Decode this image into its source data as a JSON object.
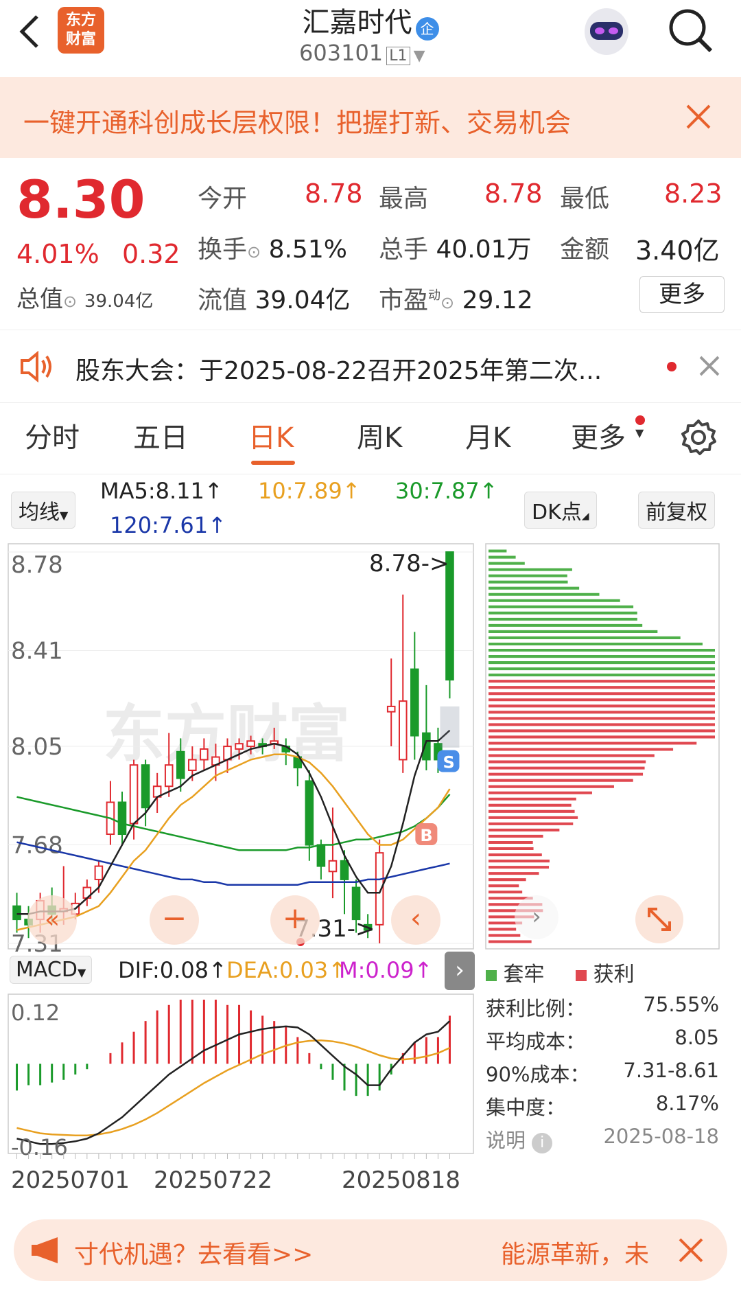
{
  "header": {
    "stock_name": "汇嘉时代",
    "badge": "企",
    "code": "603101",
    "level": "L1",
    "logo_line1": "东方",
    "logo_line2": "财富"
  },
  "banner": {
    "text": "一键开通科创成长层权限！把握打新、交易机会"
  },
  "quote": {
    "price": "8.30",
    "change_pct": "4.01%",
    "change_abs": "0.32",
    "open_label": "今开",
    "open": "8.78",
    "high_label": "最高",
    "high": "8.78",
    "low_label": "最低",
    "low": "8.23",
    "turnover_label": "换手",
    "turnover": "8.51%",
    "volume_label": "总手",
    "volume": "40.01万",
    "amount_label": "金额",
    "amount": "3.40亿",
    "total_value_label": "总值",
    "total_value": "39.04亿",
    "float_value_label": "流值",
    "float_value": "39.04亿",
    "pe_label": "市盈",
    "pe_sup": "动",
    "pe": "29.12",
    "more_label": "更多"
  },
  "notice": {
    "text": "股东大会：于2025-08-22召开2025年第二次..."
  },
  "tabs": [
    "分时",
    "五日",
    "日K",
    "周K",
    "月K",
    "更多"
  ],
  "active_tab": "日K",
  "indicators": {
    "ma_selector": "均线",
    "ma5": "MA5:8.11↑",
    "ma10": "10:7.89↑",
    "ma30": "30:7.87↑",
    "ma120": "120:7.61↑",
    "dk_button": "DK点",
    "adjust_button": "前复权"
  },
  "kline": {
    "y_labels": [
      "8.78",
      "8.41",
      "8.05",
      "7.68",
      "7.31"
    ],
    "max_annotation": "8.78->",
    "min_annotation": "7.31->",
    "watermark": "东方财富",
    "buy_marker": "B",
    "sell_marker": "S"
  },
  "macd": {
    "selector": "MACD",
    "dif": "DIF:0.08↑",
    "dea": "DEA:0.03↑",
    "m": "M:0.09↑",
    "y_top": "0.12",
    "y_bottom": "-0.16"
  },
  "x_labels": [
    "20250701",
    "20250722",
    "20250818"
  ],
  "chips": {
    "legend_trapped": "套牢",
    "legend_profit": "获利",
    "profit_ratio_label": "获利比例：",
    "profit_ratio": "75.55%",
    "avg_cost_label": "平均成本：",
    "avg_cost": "8.05",
    "cost90_label": "90%成本：",
    "cost90": "7.31-8.61",
    "concentration_label": "集中度：",
    "concentration": "8.17%",
    "explain_label": "说明",
    "date": "2025-08-18"
  },
  "footer_ad": {
    "left_text": "寸代机遇？去看看>>",
    "right_text": "能源革新，未"
  },
  "colors": {
    "up": "#e0292f",
    "down": "#1a9a2a",
    "accent": "#e8612c",
    "ma5": "#222222",
    "ma10": "#e8a020",
    "ma30": "#1a9a2a",
    "ma120": "#1a37a8"
  },
  "chart_data": {
    "type": "candlestick",
    "ylim": [
      7.31,
      8.78
    ],
    "candles": [
      {
        "o": 7.45,
        "c": 7.4,
        "h": 7.5,
        "l": 7.35
      },
      {
        "o": 7.4,
        "c": 7.38,
        "h": 7.45,
        "l": 7.33
      },
      {
        "o": 7.4,
        "c": 7.47,
        "h": 7.5,
        "l": 7.35
      },
      {
        "o": 7.45,
        "c": 7.42,
        "h": 7.52,
        "l": 7.38
      },
      {
        "o": 7.43,
        "c": 7.44,
        "h": 7.6,
        "l": 7.38
      },
      {
        "o": 7.42,
        "c": 7.46,
        "h": 7.5,
        "l": 7.4
      },
      {
        "o": 7.48,
        "c": 7.52,
        "h": 7.55,
        "l": 7.45
      },
      {
        "o": 7.55,
        "c": 7.6,
        "h": 7.62,
        "l": 7.5
      },
      {
        "o": 7.72,
        "c": 7.84,
        "h": 7.92,
        "l": 7.68
      },
      {
        "o": 7.84,
        "c": 7.72,
        "h": 7.88,
        "l": 7.68
      },
      {
        "o": 7.76,
        "c": 7.98,
        "h": 8.0,
        "l": 7.7
      },
      {
        "o": 7.98,
        "c": 7.82,
        "h": 8.0,
        "l": 7.75
      },
      {
        "o": 7.86,
        "c": 7.9,
        "h": 7.95,
        "l": 7.8
      },
      {
        "o": 7.9,
        "c": 7.98,
        "h": 8.1,
        "l": 7.86
      },
      {
        "o": 8.03,
        "c": 7.93,
        "h": 8.08,
        "l": 7.88
      },
      {
        "o": 7.96,
        "c": 8.0,
        "h": 8.05,
        "l": 7.92
      },
      {
        "o": 8.0,
        "c": 8.04,
        "h": 8.08,
        "l": 7.96
      },
      {
        "o": 7.98,
        "c": 8.01,
        "h": 8.06,
        "l": 7.92
      },
      {
        "o": 8.0,
        "c": 8.05,
        "h": 8.08,
        "l": 7.95
      },
      {
        "o": 8.04,
        "c": 8.06,
        "h": 8.08,
        "l": 8.0
      },
      {
        "o": 8.05,
        "c": 8.07,
        "h": 8.09,
        "l": 8.02
      },
      {
        "o": 8.06,
        "c": 8.05,
        "h": 8.08,
        "l": 8.02
      },
      {
        "o": 8.06,
        "c": 8.07,
        "h": 8.12,
        "l": 8.04
      },
      {
        "o": 8.05,
        "c": 8.03,
        "h": 8.08,
        "l": 7.98
      },
      {
        "o": 8.01,
        "c": 7.97,
        "h": 8.03,
        "l": 7.9
      },
      {
        "o": 7.92,
        "c": 7.68,
        "h": 7.96,
        "l": 7.62
      },
      {
        "o": 7.68,
        "c": 7.6,
        "h": 7.7,
        "l": 7.55
      },
      {
        "o": 7.58,
        "c": 7.62,
        "h": 7.82,
        "l": 7.48
      },
      {
        "o": 7.62,
        "c": 7.55,
        "h": 7.66,
        "l": 7.42
      },
      {
        "o": 7.52,
        "c": 7.4,
        "h": 7.55,
        "l": 7.35
      },
      {
        "o": 7.38,
        "c": 7.36,
        "h": 7.42,
        "l": 7.33
      },
      {
        "o": 7.38,
        "c": 7.65,
        "h": 7.7,
        "l": 7.31
      },
      {
        "o": 8.18,
        "c": 8.2,
        "h": 8.38,
        "l": 8.05
      },
      {
        "o": 8.0,
        "c": 8.22,
        "h": 8.62,
        "l": 7.95
      },
      {
        "o": 8.34,
        "c": 8.09,
        "h": 8.48,
        "l": 8.0
      },
      {
        "o": 8.1,
        "c": 8.0,
        "h": 8.28,
        "l": 7.96
      },
      {
        "o": 8.06,
        "c": 8.0,
        "h": 8.12,
        "l": 7.95
      },
      {
        "o": 8.78,
        "c": 8.3,
        "h": 8.78,
        "l": 8.23
      }
    ],
    "ma5": [
      7.42,
      7.42,
      7.43,
      7.43,
      7.43,
      7.44,
      7.48,
      7.52,
      7.6,
      7.68,
      7.76,
      7.8,
      7.86,
      7.88,
      7.9,
      7.94,
      7.96,
      7.98,
      8.0,
      8.02,
      8.04,
      8.05,
      8.06,
      8.05,
      8.02,
      7.95,
      7.86,
      7.75,
      7.64,
      7.56,
      7.5,
      7.5,
      7.6,
      7.76,
      7.94,
      8.07,
      8.07,
      8.11
    ],
    "ma10": [
      7.36,
      7.37,
      7.38,
      7.39,
      7.4,
      7.41,
      7.43,
      7.45,
      7.5,
      7.56,
      7.62,
      7.66,
      7.72,
      7.78,
      7.83,
      7.86,
      7.9,
      7.94,
      7.96,
      7.98,
      8.0,
      8.01,
      8.02,
      8.02,
      8.01,
      7.99,
      7.95,
      7.9,
      7.84,
      7.78,
      7.72,
      7.68,
      7.68,
      7.7,
      7.74,
      7.78,
      7.82,
      7.89
    ],
    "ma30": [
      7.86,
      7.85,
      7.84,
      7.83,
      7.82,
      7.81,
      7.8,
      7.79,
      7.78,
      7.76,
      7.75,
      7.74,
      7.73,
      7.72,
      7.71,
      7.7,
      7.69,
      7.68,
      7.67,
      7.66,
      7.66,
      7.66,
      7.66,
      7.66,
      7.67,
      7.67,
      7.68,
      7.68,
      7.69,
      7.7,
      7.7,
      7.71,
      7.72,
      7.73,
      7.75,
      7.78,
      7.82,
      7.87
    ],
    "ma120": [
      7.69,
      7.68,
      7.67,
      7.66,
      7.65,
      7.64,
      7.63,
      7.62,
      7.61,
      7.6,
      7.59,
      7.58,
      7.57,
      7.56,
      7.55,
      7.55,
      7.54,
      7.54,
      7.53,
      7.53,
      7.53,
      7.53,
      7.53,
      7.53,
      7.53,
      7.54,
      7.54,
      7.54,
      7.54,
      7.54,
      7.55,
      7.55,
      7.56,
      7.57,
      7.58,
      7.59,
      7.6,
      7.61
    ],
    "macd_ylim": [
      -0.16,
      0.12
    ],
    "dif": [
      -0.14,
      -0.145,
      -0.15,
      -0.15,
      -0.148,
      -0.145,
      -0.14,
      -0.13,
      -0.115,
      -0.1,
      -0.08,
      -0.06,
      -0.04,
      -0.02,
      -0.005,
      0.01,
      0.025,
      0.035,
      0.045,
      0.055,
      0.06,
      0.065,
      0.068,
      0.07,
      0.068,
      0.055,
      0.035,
      0.015,
      -0.005,
      -0.02,
      -0.04,
      -0.04,
      -0.01,
      0.015,
      0.04,
      0.055,
      0.06,
      0.08
    ],
    "dea": [
      -0.12,
      -0.125,
      -0.13,
      -0.132,
      -0.133,
      -0.134,
      -0.134,
      -0.132,
      -0.128,
      -0.122,
      -0.114,
      -0.104,
      -0.092,
      -0.078,
      -0.064,
      -0.05,
      -0.036,
      -0.024,
      -0.012,
      -0.002,
      0.008,
      0.018,
      0.026,
      0.034,
      0.04,
      0.043,
      0.044,
      0.042,
      0.038,
      0.032,
      0.024,
      0.016,
      0.01,
      0.008,
      0.01,
      0.014,
      0.02,
      0.03
    ],
    "macd_bar": [
      -0.05,
      -0.04,
      -0.04,
      -0.035,
      -0.03,
      -0.02,
      -0.01,
      0.0,
      0.02,
      0.04,
      0.06,
      0.08,
      0.1,
      0.11,
      0.12,
      0.12,
      0.12,
      0.12,
      0.11,
      0.11,
      0.1,
      0.09,
      0.08,
      0.07,
      0.05,
      0.02,
      -0.01,
      -0.03,
      -0.05,
      -0.06,
      -0.06,
      -0.05,
      -0.02,
      0.02,
      0.04,
      0.05,
      0.05,
      0.09
    ],
    "chips_rows": 64,
    "chips_split_row": 21
  }
}
